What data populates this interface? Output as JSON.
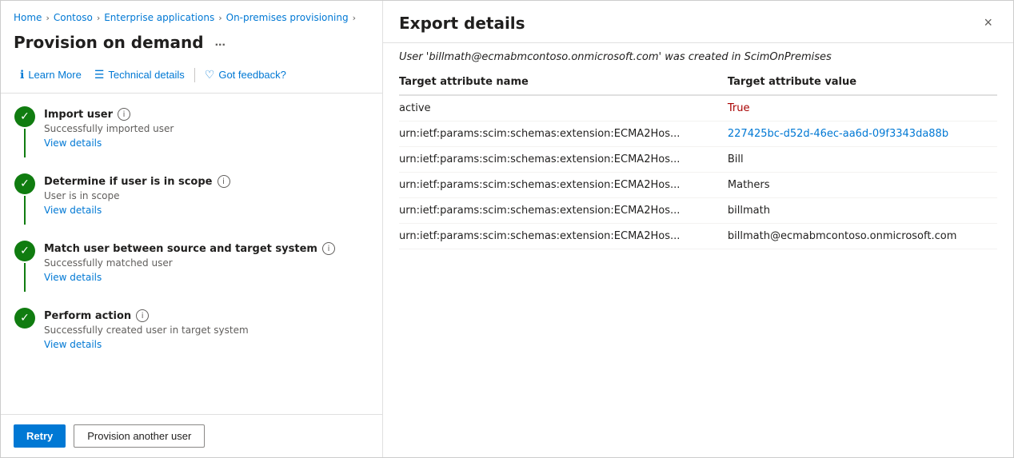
{
  "breadcrumb": {
    "items": [
      {
        "label": "Home",
        "link": true
      },
      {
        "label": "Contoso",
        "link": true
      },
      {
        "label": "Enterprise applications",
        "link": true
      },
      {
        "label": "On-premises provisioning",
        "link": true
      }
    ]
  },
  "left": {
    "page_title": "Provision on demand",
    "ellipsis": "...",
    "toolbar": {
      "learn_more": "Learn More",
      "technical_details": "Technical details",
      "got_feedback": "Got feedback?"
    },
    "steps": [
      {
        "title": "Import user",
        "desc": "Successfully imported user",
        "link": "View details"
      },
      {
        "title": "Determine if user is in scope",
        "desc": "User is in scope",
        "link": "View details"
      },
      {
        "title": "Match user between source and target system",
        "desc": "Successfully matched user",
        "link": "View details"
      },
      {
        "title": "Perform action",
        "desc": "Successfully created user in target system",
        "link": "View details"
      }
    ],
    "buttons": {
      "retry": "Retry",
      "provision_another": "Provision another user"
    }
  },
  "right": {
    "title": "Export details",
    "close_icon": "×",
    "subtitle_prefix": "User ",
    "subtitle_user": "'billmath@ecmabmcontoso.onmicrosoft.com'",
    "subtitle_suffix": " was created in ScimOnPremises",
    "table": {
      "col1": "Target attribute name",
      "col2": "Target attribute value",
      "rows": [
        {
          "attr": "active",
          "value": "True",
          "style": "red"
        },
        {
          "attr": "urn:ietf:params:scim:schemas:extension:ECMA2Hos...",
          "value": "227425bc-d52d-46ec-aa6d-09f3343da88b",
          "style": "blue"
        },
        {
          "attr": "urn:ietf:params:scim:schemas:extension:ECMA2Hos...",
          "value": "Bill",
          "style": "plain"
        },
        {
          "attr": "urn:ietf:params:scim:schemas:extension:ECMA2Hos...",
          "value": "Mathers",
          "style": "plain"
        },
        {
          "attr": "urn:ietf:params:scim:schemas:extension:ECMA2Hos...",
          "value": "billmath",
          "style": "plain"
        },
        {
          "attr": "urn:ietf:params:scim:schemas:extension:ECMA2Hos...",
          "value": "billmath@ecmabmcontoso.onmicrosoft.com",
          "style": "plain"
        }
      ]
    }
  }
}
